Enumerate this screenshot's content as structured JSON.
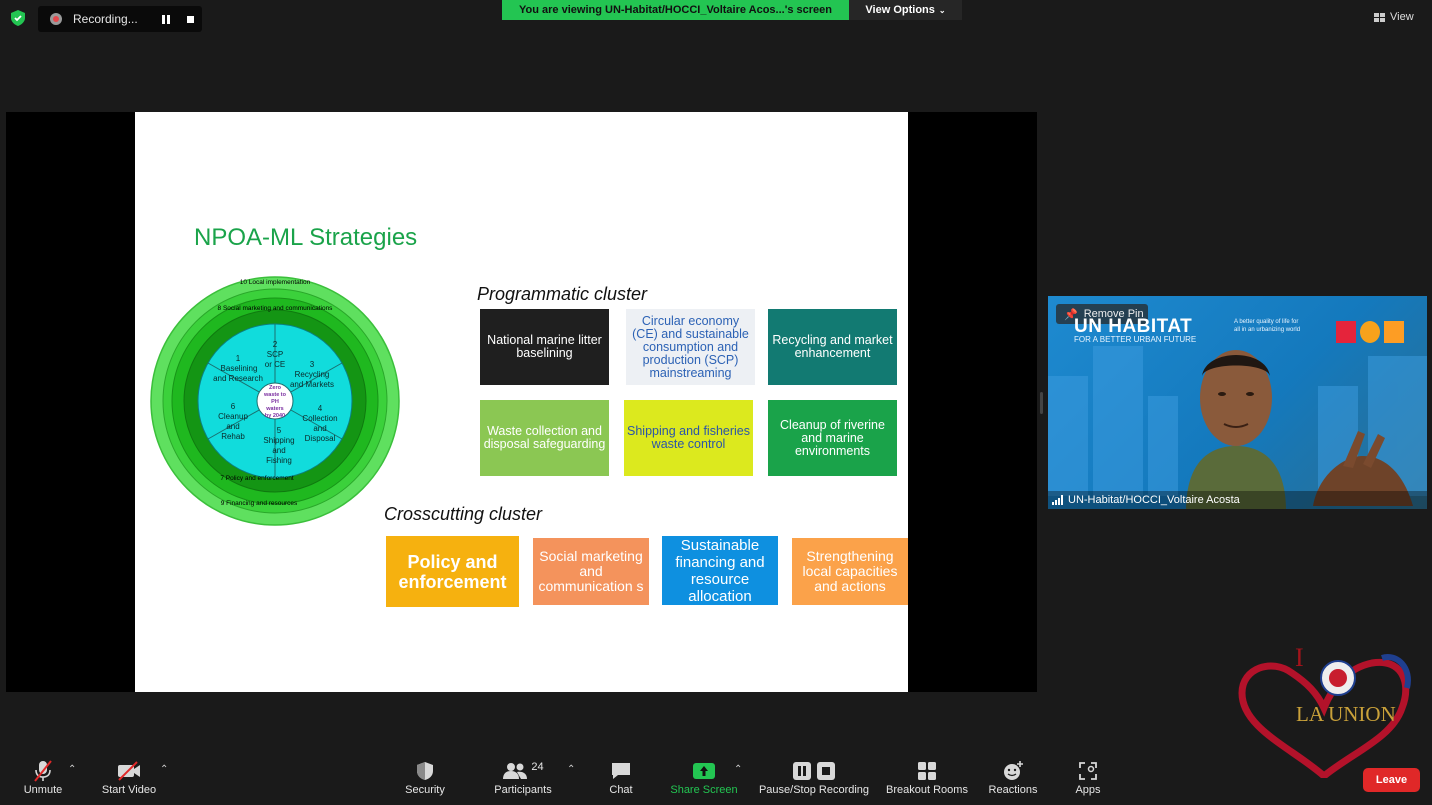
{
  "top": {
    "recording_label": "Recording...",
    "banner_text": "You are viewing UN-Habitat/HOCCI_Voltaire Acos...'s screen",
    "view_options": "View Options",
    "view_label": "View"
  },
  "slide": {
    "title": "NPOA-ML Strategies",
    "wheel": {
      "outer_rings": [
        "10 Local implementation",
        "8 Social marketing and communications",
        "7 Policy and enforcement",
        "9 Financing and resources"
      ],
      "segments": [
        "1 Baselining and Research",
        "2 SCP or CE",
        "3 Recycling and Markets",
        "4 Collection and Disposal",
        "5 Shipping and Fishing",
        "6 Cleanup and Rehab"
      ],
      "center": [
        "Zero",
        "waste to",
        "PH",
        "waters",
        "by 2040"
      ]
    },
    "programmatic_label": "Programmatic cluster",
    "programmatic": [
      {
        "text": "National marine litter baselining",
        "bg": "#1f1f1f",
        "fg": "#ffffff"
      },
      {
        "text": "Circular economy (CE) and sustainable consumption and production (SCP) mainstreaming",
        "bg": "#edf0f4",
        "fg": "#2c62b5"
      },
      {
        "text": "Recycling and market enhancement",
        "bg": "#127a72",
        "fg": "#ffffff"
      },
      {
        "text": "Waste collection and disposal safeguarding",
        "bg": "#8bc753",
        "fg": "#ffffff"
      },
      {
        "text": "Shipping and fisheries waste control",
        "bg": "#dce91e",
        "fg": "#2b55a8"
      },
      {
        "text": "Cleanup of riverine and marine environments",
        "bg": "#1aa34a",
        "fg": "#ffffff"
      }
    ],
    "crosscutting_label": "Crosscutting cluster",
    "crosscutting": [
      {
        "text": "Policy and enforcement",
        "bg": "#f6b10f",
        "fg": "#ffffff"
      },
      {
        "text": "Social marketing and communication s",
        "bg": "#f4935c",
        "fg": "#ffffff"
      },
      {
        "text": "Sustainable financing and resource allocation",
        "bg": "#0e90e0",
        "fg": "#ffffff"
      },
      {
        "text": "Strengthening local capacities and actions",
        "bg": "#fba24a",
        "fg": "#ffffff"
      }
    ]
  },
  "speaker": {
    "remove_pin": "Remove Pin",
    "org_name": "UN HABITAT",
    "org_sub": "FOR A BETTER URBAN FUTURE",
    "tagline": "A better quality of life for all in an urbanizing world",
    "name": "UN-Habitat/HOCCI_Voltaire Acosta"
  },
  "logo": {
    "line1": "I",
    "line2": "LA UNION"
  },
  "toolbar": {
    "unmute": "Unmute",
    "start_video": "Start Video",
    "security": "Security",
    "participants": "Participants",
    "participants_count": "24",
    "chat": "Chat",
    "share_screen": "Share Screen",
    "pause_recording": "Pause/Stop Recording",
    "breakout_rooms": "Breakout Rooms",
    "reactions": "Reactions",
    "apps": "Apps",
    "leave": "Leave"
  },
  "colors": {
    "accent_green": "#23c552",
    "leave_red": "#e02828",
    "slide_title_green": "#1aa34a"
  }
}
